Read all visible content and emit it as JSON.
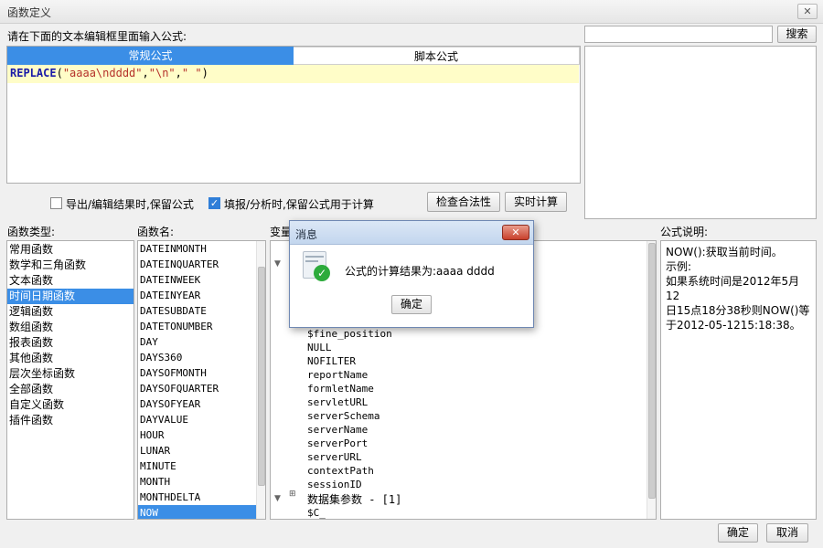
{
  "window": {
    "title": "函数定义",
    "close_glyph": "✕"
  },
  "instruction": "请在下面的文本编辑框里面输入公式:",
  "search": {
    "value": "",
    "button_label": "搜索"
  },
  "formula_tabs": [
    {
      "label": "常规公式",
      "active": true
    },
    {
      "label": "脚本公式",
      "active": false
    }
  ],
  "formula": {
    "keyword": "REPLACE",
    "open": "(",
    "arg1": "\"aaaa\\ndddd\"",
    "sep1": ",",
    "arg2": "\"\\n\"",
    "sep2": ",",
    "arg3": "\" \"",
    "close": ")"
  },
  "options": {
    "keep_formula_export": {
      "label": "导出/编辑结果时,保留公式",
      "checked": false
    },
    "keep_formula_fill": {
      "label": "填报/分析时,保留公式用于计算",
      "checked": true
    }
  },
  "buttons": {
    "check_validity": "检查合法性",
    "realtime_calc": "实时计算",
    "ok": "确定",
    "cancel": "取消"
  },
  "function_types": {
    "header": "函数类型:",
    "items": [
      "常用函数",
      "数学和三角函数",
      "文本函数",
      "时间日期函数",
      "逻辑函数",
      "数组函数",
      "报表函数",
      "其他函数",
      "层次坐标函数",
      "全部函数",
      "自定义函数",
      "插件函数"
    ],
    "selected_index": 3
  },
  "function_names": {
    "header": "函数名:",
    "items": [
      "DATEINMONTH",
      "DATEINQUARTER",
      "DATEINWEEK",
      "DATEINYEAR",
      "DATESUBDATE",
      "DATETONUMBER",
      "DAY",
      "DAYS360",
      "DAYSOFMONTH",
      "DAYSOFQUARTER",
      "DAYSOFYEAR",
      "DAYVALUE",
      "HOUR",
      "LUNAR",
      "MINUTE",
      "MONTH",
      "MONTHDELTA",
      "NOW"
    ],
    "selected_index": 17
  },
  "variables": {
    "header": "变量",
    "items": [
      "$fine_position",
      "NULL",
      "NOFILTER",
      "reportName",
      "formletName",
      "servletURL",
      "serverSchema",
      "serverName",
      "serverPort",
      "serverURL",
      "contextPath",
      "sessionID"
    ],
    "group_label": "数据集参数 - [1]",
    "group_item": "$C_"
  },
  "description": {
    "header": "公式说明:",
    "lines": [
      "NOW():获取当前时间。",
      "示例:",
      "如果系统时间是2012年5月12",
      "日15点18分38秒则NOW()等",
      "于2012-05-1215:18:38。"
    ]
  },
  "message_dialog": {
    "title": "消息",
    "text": "公式的计算结果为:aaaa dddd",
    "ok_label": "确定"
  },
  "colors": {
    "accent": "#3b8ee6",
    "editor_highlight": "#fffdc8"
  }
}
